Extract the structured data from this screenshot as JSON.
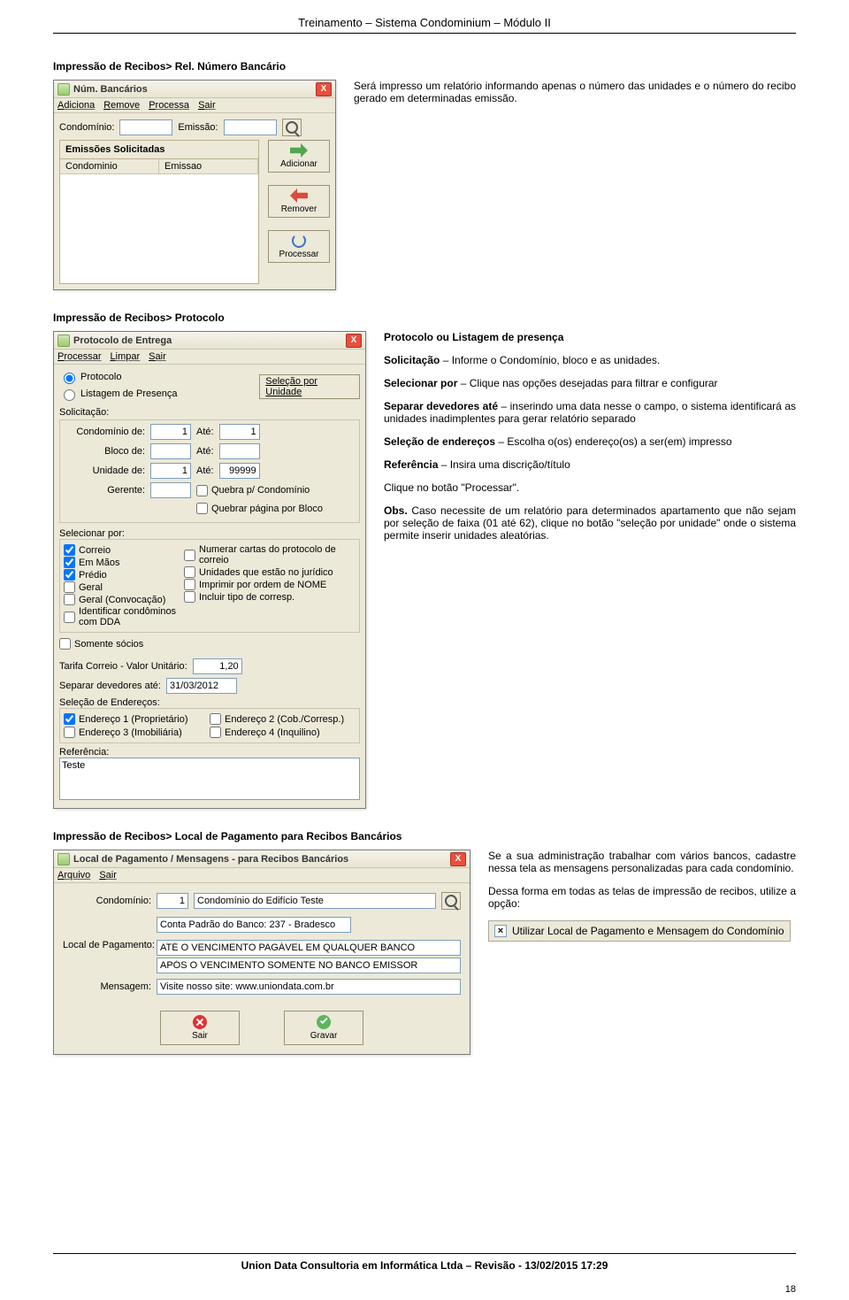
{
  "doc_header": "Treinamento – Sistema Condominium – Módulo II",
  "section1": {
    "title": "Impressão de Recibos> Rel. Número Bancário",
    "desc": "Será impresso um relatório informando apenas o número das unidades e o número do recibo gerado em determinadas emissão.",
    "win": {
      "title": "Núm. Bancários",
      "menu": [
        "Adiciona",
        "Remove",
        "Processa",
        "Sair"
      ],
      "fields": {
        "condo_lbl": "Condomínio:",
        "emissao_lbl": "Emissão:"
      },
      "group": {
        "title": "Emissões Solicitadas",
        "cols": [
          "Condominio",
          "Emissao"
        ],
        "buttons": {
          "add": "Adicionar",
          "rem": "Remover",
          "proc": "Processar"
        }
      }
    }
  },
  "section2": {
    "title": "Impressão de Recibos> Protocolo",
    "win": {
      "title": "Protocolo de Entrega",
      "menu": [
        "Processar",
        "Limpar",
        "Sair"
      ],
      "radios": {
        "proto": "Protocolo",
        "list": "Listagem de Presença"
      },
      "selbtn": "Seleção por Unidade",
      "solic_lbl": "Solicitação:",
      "fields": {
        "condo_de": "Condomínio de:",
        "condo_de_v": "1",
        "condo_ate": "Até:",
        "condo_ate_v": "1",
        "bloco_de": "Bloco de:",
        "bloco_ate": "Até:",
        "unid_de": "Unidade de:",
        "unid_de_v": "1",
        "unid_ate": "Até:",
        "unid_ate_v": "99999",
        "ger": "Gerente:",
        "quebra_condo": "Quebra p/ Condomínio",
        "quebra_bloco": "Quebrar página por Bloco"
      },
      "selpor_lbl": "Selecionar por:",
      "left_cb": [
        {
          "l": "Correio",
          "c": true
        },
        {
          "l": "Em Mãos",
          "c": true
        },
        {
          "l": "Prédio",
          "c": true
        },
        {
          "l": "Geral",
          "c": false
        },
        {
          "l": "Geral (Convocação)",
          "c": false
        },
        {
          "l": "Identificar condôminos com DDA",
          "c": false
        }
      ],
      "right_cb": [
        {
          "l": "Numerar cartas do protocolo de correio",
          "c": false
        },
        {
          "l": "Unidades que estão no jurídico",
          "c": false
        },
        {
          "l": "Imprimir por ordem de NOME",
          "c": false
        },
        {
          "l": "Incluir tipo de corresp.",
          "c": false
        }
      ],
      "socios_cb": "Somente sócios",
      "tarifa_lbl": "Tarifa Correio - Valor Unitário:",
      "tarifa_v": "1,20",
      "devate_lbl": "Separar devedores até:",
      "devate_v": "31/03/2012",
      "endgrp": "Seleção de Endereços:",
      "end_cb": [
        {
          "l": "Endereço 1 (Proprietário)",
          "c": true
        },
        {
          "l": "Endereço 2 (Cob./Corresp.)",
          "c": false
        },
        {
          "l": "Endereço 3 (Imobiliária)",
          "c": false
        },
        {
          "l": "Endereço 4 (Inquilino)",
          "c": false
        }
      ],
      "ref_lbl": "Referência:",
      "ref_v": "Teste"
    },
    "text": {
      "h1": "Protocolo ou Listagem de presença",
      "p1a": "Solicitação",
      "p1b": " – Informe o Condomínio, bloco e as unidades.",
      "p2a": "Selecionar por",
      "p2b": " – Clique nas opções desejadas para filtrar e configurar",
      "p3a": "Separar devedores até",
      "p3b": " – inserindo uma data nesse o campo, o sistema identificará as unidades inadimplentes para gerar relatório separado",
      "p4a": "Seleção de endereços",
      "p4b": " – Escolha o(os) endereço(os) a ser(em) impresso",
      "p5a": "Referência",
      "p5b": " – Insira uma discrição/título",
      "p6": "Clique no botão \"Processar\".",
      "p7a": "Obs.",
      "p7b": " Caso necessite de um relatório para determinados apartamento que não sejam por seleção de faixa (01 até 62), clique no botão \"seleção por unidade\" onde o sistema permite inserir unidades aleatórias."
    }
  },
  "section3": {
    "title": "Impressão de Recibos> Local de Pagamento para Recibos Bancários",
    "win": {
      "title": "Local de Pagamento / Mensagens  - para Recibos Bancários",
      "menu": [
        "Arquivo",
        "Sair"
      ],
      "condo_lbl": "Condomínio:",
      "condo_num": "1",
      "condo_nome": "Condomínio do Edifício Teste",
      "banco_lbl": "Conta Padrão do Banco: 237 - Bradesco",
      "local_lbl": "Local de Pagamento:",
      "local1": "ATÉ O VENCIMENTO PAGÁVEL EM QUALQUER BANCO",
      "local2": "APÓS O VENCIMENTO SOMENTE NO BANCO EMISSOR",
      "msg_lbl": "Mensagem:",
      "msg_v": "Visite nosso site: www.uniondata.com.br",
      "btn_sair": "Sair",
      "btn_gravar": "Gravar"
    },
    "text": {
      "p1": "Se a sua administração trabalhar com vários bancos, cadastre nessa tela as mensagens personalizadas para cada condomínio.",
      "p2": "Dessa forma em todas as telas de impressão de recibos, utilize a opção:"
    },
    "chk_label": "Utilizar Local de Pagamento e Mensagem do Condomínio"
  },
  "footer": "Union Data Consultoria em Informática Ltda – Revisão - 13/02/2015 17:29",
  "page_num": "18"
}
